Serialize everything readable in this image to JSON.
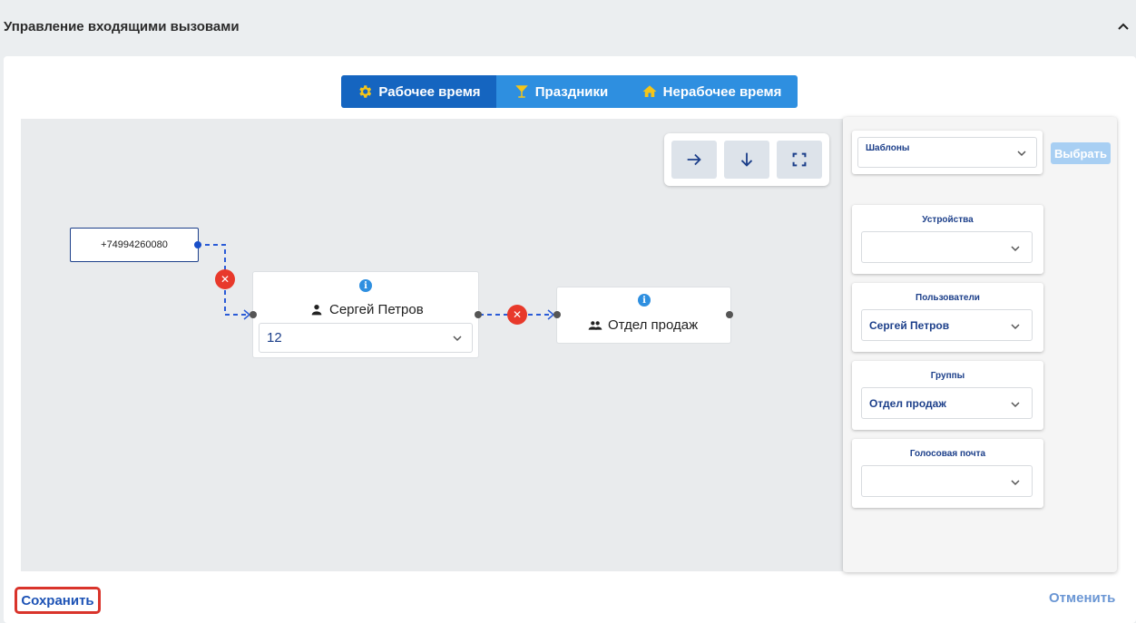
{
  "header": {
    "title": "Управление входящими вызовами"
  },
  "tabs": [
    {
      "label": "Рабочее время",
      "icon": "gear-icon",
      "active": true
    },
    {
      "label": "Праздники",
      "icon": "cocktail-icon",
      "active": false
    },
    {
      "label": "Нерабочее время",
      "icon": "home-icon",
      "active": false
    }
  ],
  "flow": {
    "phone_number": "+74994260080",
    "user_node": {
      "name": "Сергей Петров",
      "extension": "12"
    },
    "group_node": {
      "name": "Отдел продаж"
    }
  },
  "side_panel": {
    "templates_label": "Шаблоны",
    "choose_button": "Выбрать",
    "sections": [
      {
        "title": "Устройства",
        "value": ""
      },
      {
        "title": "Пользователи",
        "value": "Сергей Петров"
      },
      {
        "title": "Группы",
        "value": "Отдел продаж"
      },
      {
        "title": "Голосовая почта",
        "value": ""
      }
    ]
  },
  "footer": {
    "save_label": "Сохранить",
    "cancel_label": "Отменить"
  },
  "colors": {
    "primary": "#1565c0",
    "tab_inactive": "#2e8fe0",
    "remove": "#e8392b",
    "save_border": "#d9342b",
    "link": "#1c52b5"
  }
}
